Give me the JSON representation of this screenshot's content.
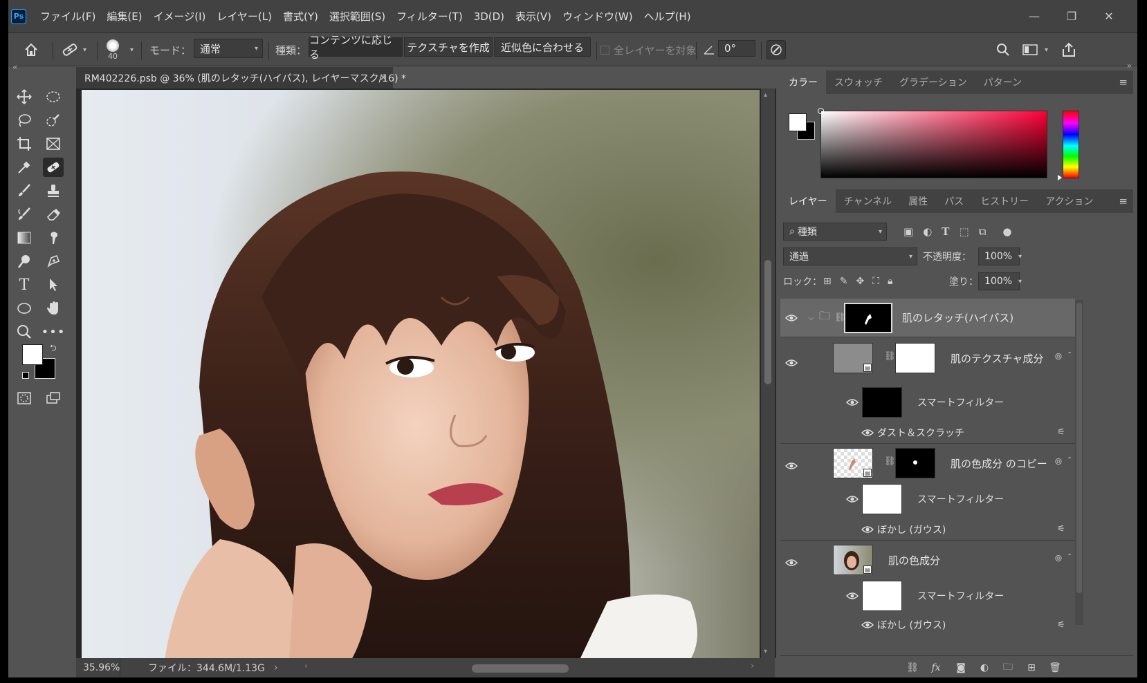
{
  "menu": {
    "items": [
      "ファイル(F)",
      "編集(E)",
      "イメージ(I)",
      "レイヤー(L)",
      "書式(Y)",
      "選択範囲(S)",
      "フィルター(T)",
      "3D(D)",
      "表示(V)",
      "ウィンドウ(W)",
      "ヘルプ(H)"
    ]
  },
  "options": {
    "brush_size": "40",
    "mode_label": "モード：",
    "mode_value": "通常",
    "type_label": "種類：",
    "type_buttons": [
      "コンテンツに応じる",
      "テクスチャを作成",
      "近似色に合わせる"
    ],
    "sample_all_label": "全レイヤーを対象",
    "angle_value": "0°"
  },
  "document": {
    "tab_title": "RM402226.psb @ 36% (肌のレタッチ(ハイパス), レイヤーマスク/16) *",
    "zoom": "35.96%",
    "file_info": "ファイル：344.6M/1.13G"
  },
  "color_panel": {
    "tabs": [
      "カラー",
      "スウォッチ",
      "グラデーション",
      "パターン"
    ],
    "active_tab": 0,
    "fg_color": "#ffffff",
    "bg_color": "#000000"
  },
  "layers_panel": {
    "tabs": [
      "レイヤー",
      "チャンネル",
      "属性",
      "パス",
      "ヒストリー",
      "アクション"
    ],
    "active_tab": 0,
    "filter_kind": "種類",
    "blend_mode": "通過",
    "opacity_label": "不透明度：",
    "opacity_value": "100%",
    "lock_label": "ロック：",
    "fill_label": "塗り：",
    "fill_value": "100%",
    "layers": [
      {
        "name": "肌のレタッチ(ハイパス)",
        "type": "group",
        "selected": true
      },
      {
        "name": "肌のテクスチャ成分",
        "type": "smart-object"
      },
      {
        "name": "スマートフィルター",
        "type": "smart-filter"
      },
      {
        "name": "ダスト＆スクラッチ",
        "type": "filter"
      },
      {
        "name": "肌の色成分 のコピー",
        "type": "smart-object"
      },
      {
        "name": "スマートフィルター",
        "type": "smart-filter"
      },
      {
        "name": "ぼかし (ガウス)",
        "type": "filter"
      },
      {
        "name": "肌の色成分",
        "type": "smart-object"
      },
      {
        "name": "スマートフィルター",
        "type": "smart-filter"
      },
      {
        "name": "ぼかし (ガウス)",
        "type": "filter"
      }
    ]
  }
}
